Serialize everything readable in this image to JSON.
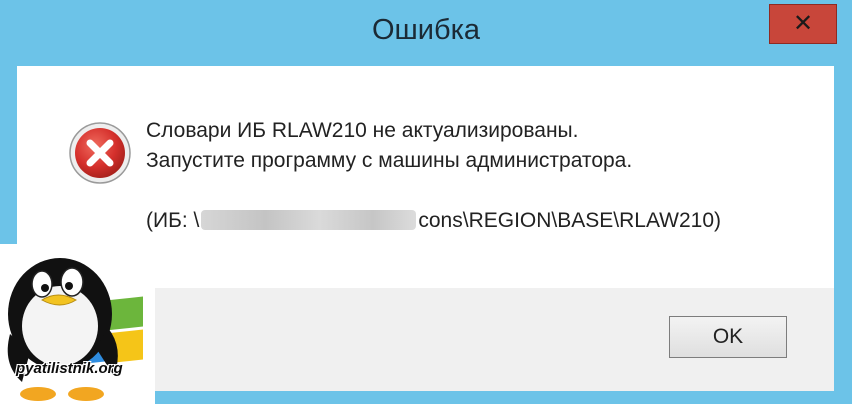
{
  "window": {
    "title": "Ошибка",
    "close_symbol": "✕"
  },
  "message": {
    "line1": "Словари ИБ RLAW210 не актуализированы.",
    "line2": "Запустите программу с машины администратора.",
    "path_prefix": "(ИБ: \\",
    "path_suffix": "cons\\REGION\\BASE\\RLAW210)"
  },
  "buttons": {
    "ok_label": "OK"
  },
  "watermark": {
    "text": "pyatilistnik.org"
  },
  "icons": {
    "error": "error-icon",
    "close": "close-icon"
  },
  "colors": {
    "title_bar": "#6cc3e8",
    "close_button": "#c8463a",
    "error_red": "#d5302c"
  }
}
